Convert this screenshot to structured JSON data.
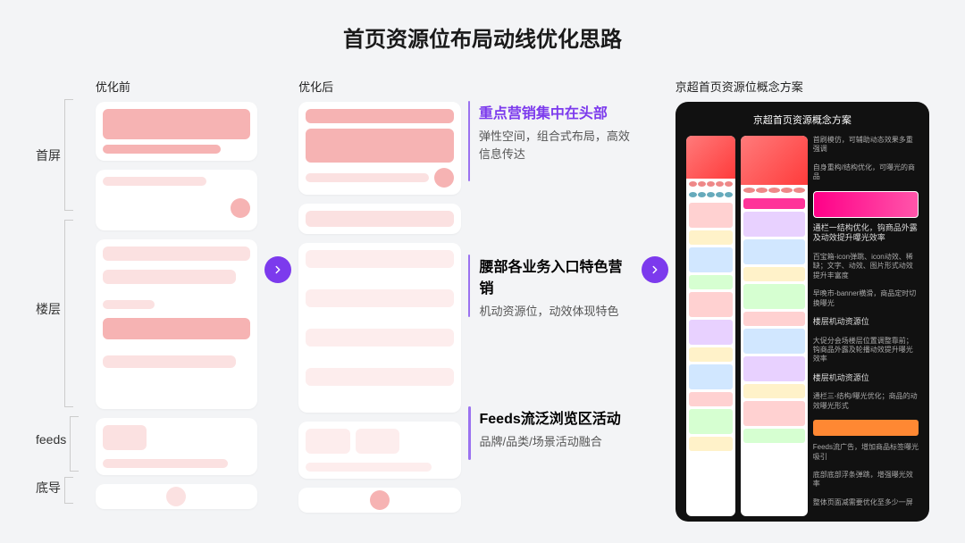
{
  "title": "首页资源位布局动线优化思路",
  "labels": {
    "l1": "首屏",
    "l2": "楼层",
    "l3": "feeds",
    "l4": "底导"
  },
  "columns": {
    "before": "优化前",
    "after": "优化后"
  },
  "concepts": {
    "c1": {
      "title": "重点营销集中在头部",
      "desc": "弹性空间，组合式布局，高效信息传达"
    },
    "c2": {
      "title": "腰部各业务入口特色营销",
      "desc": "机动资源位，动效体现特色"
    },
    "c3": {
      "title": "Feeds流泛浏览区活动",
      "desc": "品牌/品类/场景活动融合"
    }
  },
  "mockup": {
    "heading": "京超首页资源位概念方案",
    "panelTitle": "京超首页资源概念方案",
    "notes": {
      "n1": "首刷模仿，可辅助动态效果多重强调",
      "n2": "自身重构/结构优化，可曝光的商品",
      "n3": "通栏一结构优化，钩商品外露及动效提升曝光效率",
      "n4": "百宝箱-icon弹跳、icon动效、稀缺；文字、动效、图片形式动效提升丰富度",
      "n5": "早晚市-banner横滑，商品定时切换曝光",
      "n6": "楼层机动资源位",
      "n7": "大促分会场楼层位置调整靠前；钩商品外露及轮播动效提升曝光效率",
      "n8": "楼层机动资源位",
      "n9": "通栏三-结构/曝光优化；商品的动效曝光形式",
      "n10": "Feeds流广告，增加商品标签曝光吸引",
      "n11": "底部底部浮条弹跳，增强曝光效率",
      "n12": "整体页面减需要优化至多少一屏"
    }
  }
}
